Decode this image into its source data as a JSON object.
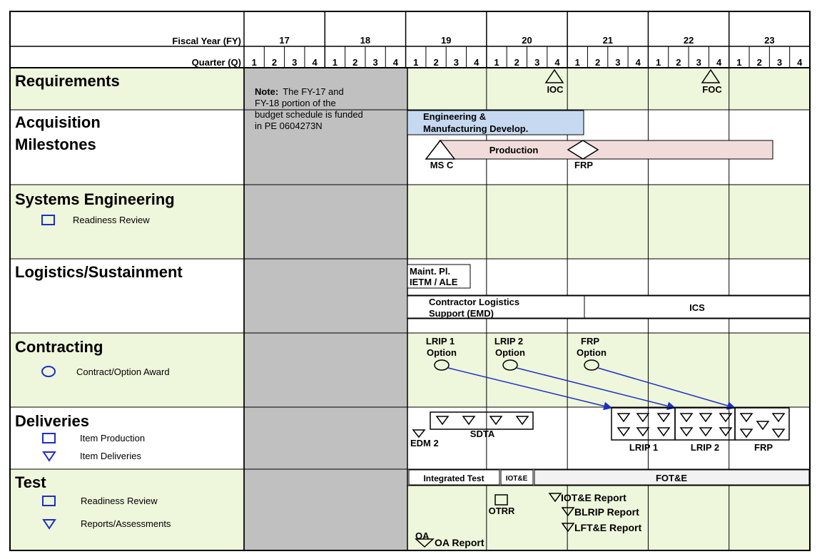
{
  "header": {
    "fy_label": "Fiscal Year (FY)",
    "q_label": "Quarter (Q)",
    "years": [
      "17",
      "18",
      "19",
      "20",
      "21",
      "22",
      "23"
    ],
    "quarters": [
      "1",
      "2",
      "3",
      "4"
    ]
  },
  "note": {
    "bold": "Note:",
    "lines": [
      "The FY-17 and",
      "FY-18 portion of the",
      "budget schedule is funded",
      "in PE 0604273N"
    ]
  },
  "sections": {
    "requirements": {
      "title": "Requirements"
    },
    "acquisition": {
      "title_lines": [
        "Acquisition",
        "Milestones"
      ]
    },
    "systems_engineering": {
      "title": "Systems Engineering",
      "legend": [
        {
          "icon": "square-icon",
          "label": "Readiness Review"
        }
      ]
    },
    "logistics": {
      "title": "Logistics/Sustainment"
    },
    "contracting": {
      "title": "Contracting",
      "legend": [
        {
          "icon": "circle-icon",
          "label": "Contract/Option Award"
        }
      ]
    },
    "deliveries": {
      "title": "Deliveries",
      "legend": [
        {
          "icon": "square-icon",
          "label": "Item Production"
        },
        {
          "icon": "triangle-down-icon",
          "label": "Item Deliveries"
        }
      ]
    },
    "test": {
      "title": "Test",
      "legend": [
        {
          "icon": "square-icon",
          "label": "Readiness Review"
        },
        {
          "icon": "triangle-down-icon",
          "label": "Reports/Assessments"
        }
      ]
    }
  },
  "requirements": {
    "ioc": "IOC",
    "foc": "FOC"
  },
  "acquisition": {
    "emd_lines": [
      "Engineering &",
      "Manufacturing Develop."
    ],
    "production": "Production",
    "msc": "MS C",
    "frp": "FRP"
  },
  "logistics": {
    "maint_lines": [
      "Maint. Pl.",
      "IETM / ALE"
    ],
    "cls_lines": [
      "Contractor Logistics",
      "Support (EMD)"
    ],
    "ics": "ICS"
  },
  "contracting": {
    "options": [
      {
        "lines": [
          "LRIP 1",
          "Option"
        ]
      },
      {
        "lines": [
          "LRIP 2",
          "Option"
        ]
      },
      {
        "lines": [
          "FRP",
          "Option"
        ]
      }
    ]
  },
  "deliveries": {
    "edm": "EDM 2",
    "sdta": "SDTA",
    "lrip1": "LRIP 1",
    "lrip2": "LRIP 2",
    "frp": "FRP"
  },
  "test": {
    "integrated": "Integrated Test",
    "iote": "IOT&E",
    "fote": "FOT&E",
    "otrr": "OTRR",
    "oa": "OA",
    "oa_report": "OA Report",
    "iote_report": "IOT&E Report",
    "blrip_report": "BLRIP Report",
    "lfte_report": "LFT&E Report"
  },
  "colors": {
    "section_bg": "#eef6dc",
    "gray_block": "#c0c0c0",
    "emd_fill": "#c6d9f1",
    "production_fill": "#f2dcdb",
    "arrow": "#1f2fbf",
    "legend_icon": "#1f2fbf",
    "bar_gray": "#f2f2f2"
  }
}
